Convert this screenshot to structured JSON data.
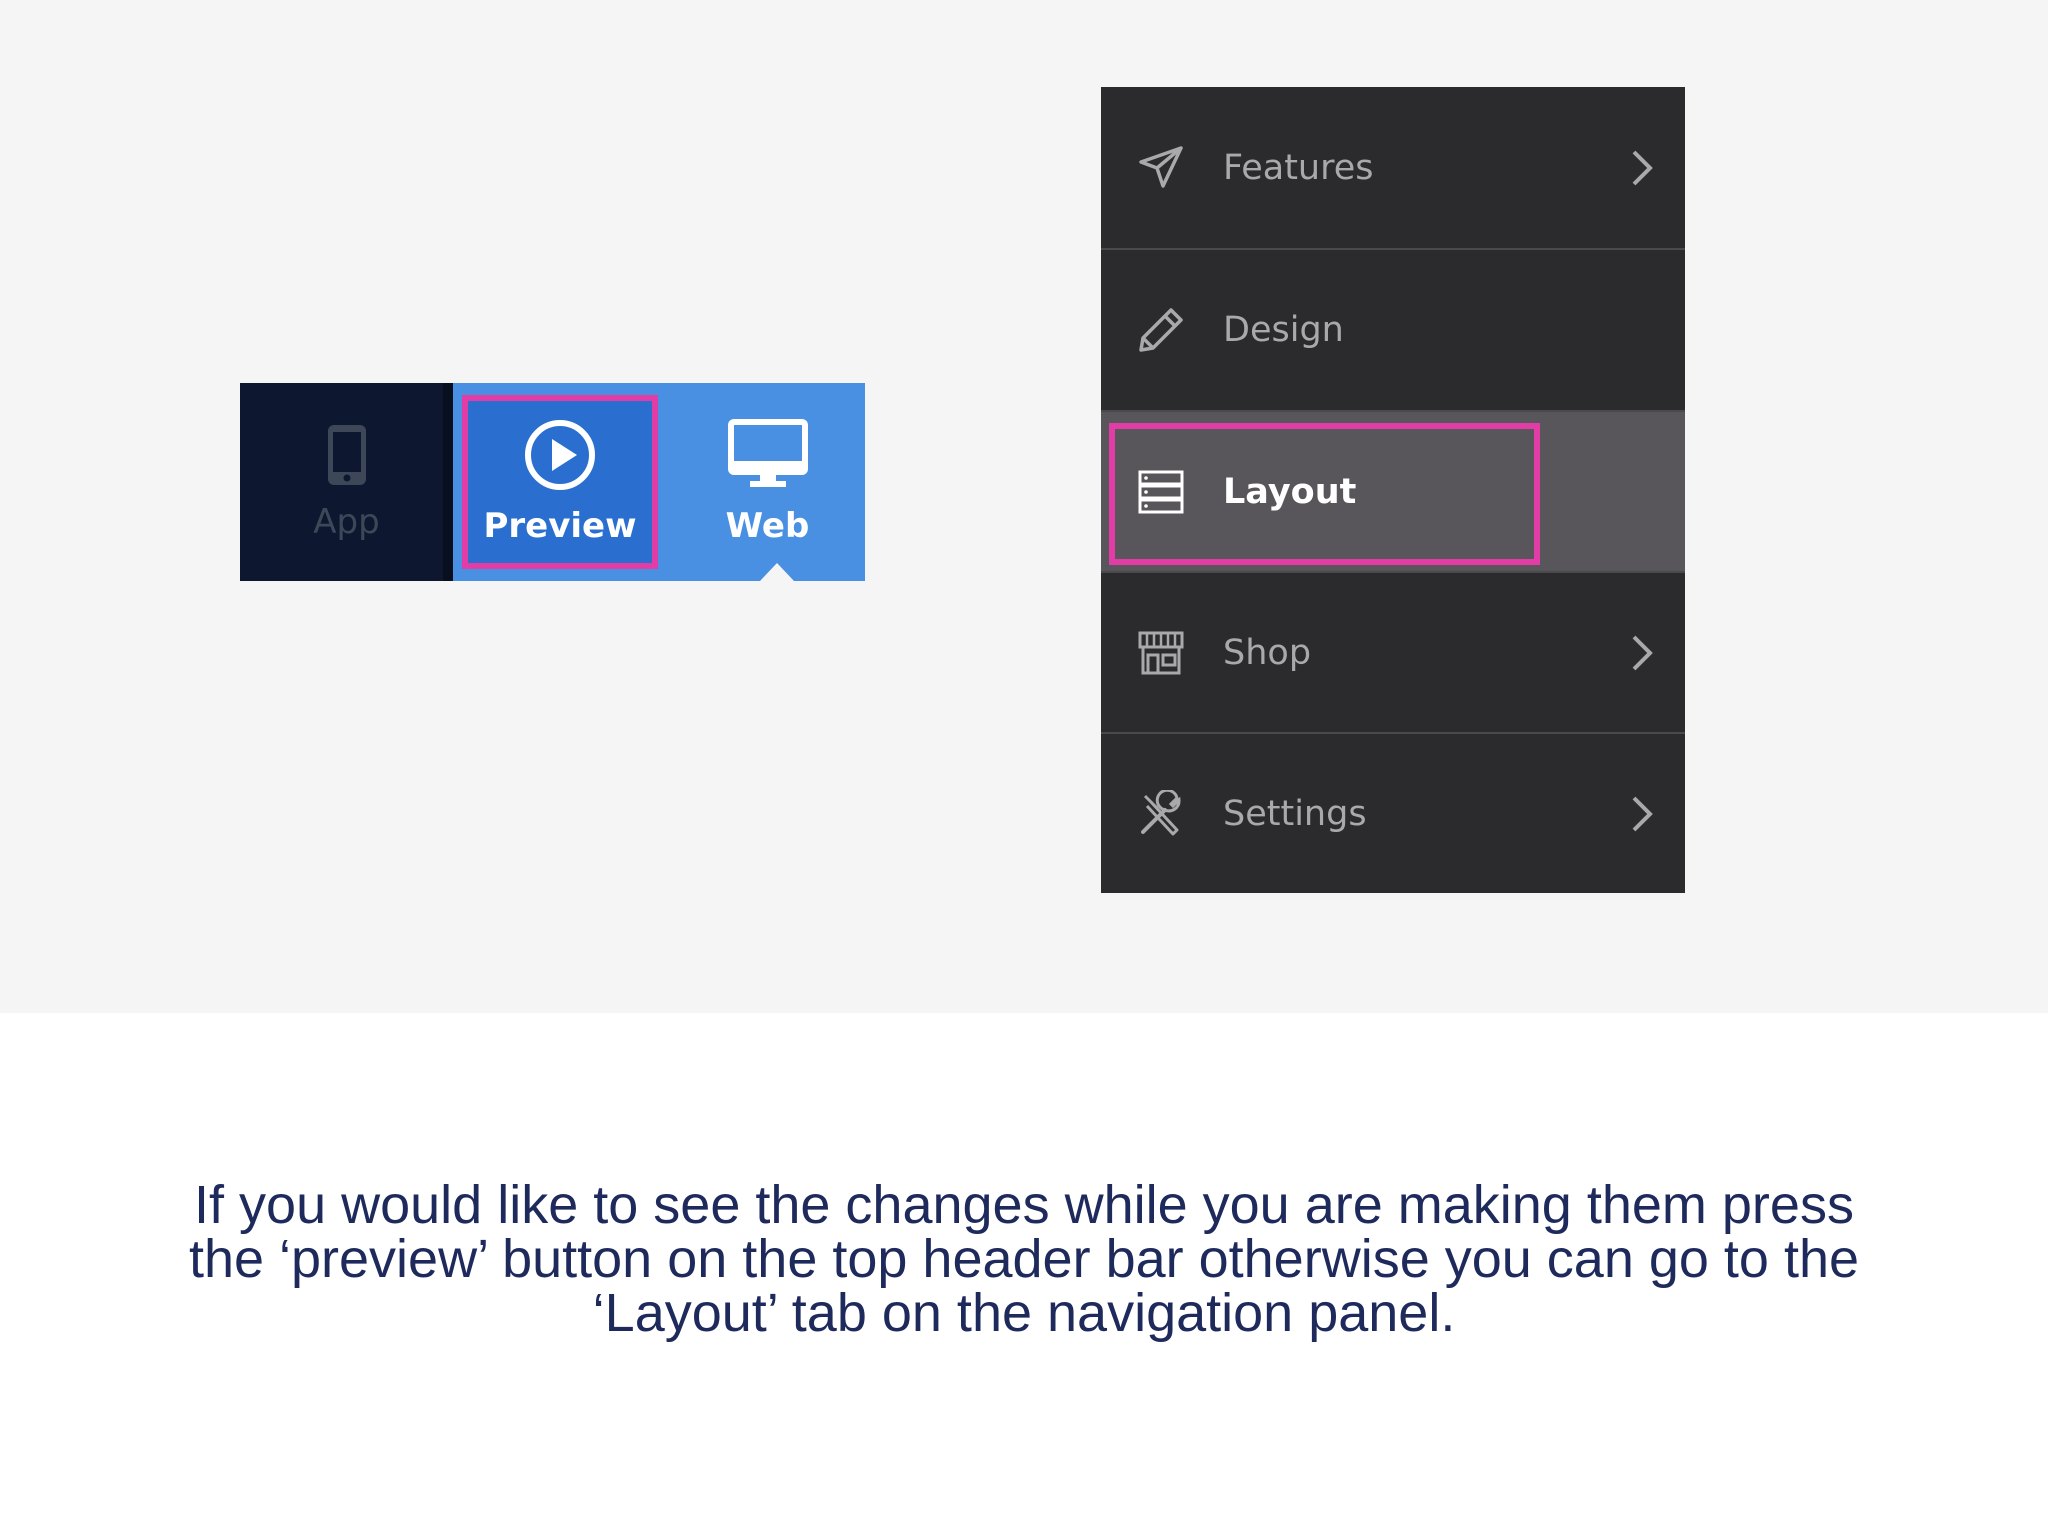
{
  "toolbar": {
    "app_label": "App",
    "preview_label": "Preview",
    "web_label": "Web"
  },
  "nav": {
    "items": [
      {
        "label": "Features",
        "icon": "paper-plane-icon",
        "has_chevron": true
      },
      {
        "label": "Design",
        "icon": "pencil-icon",
        "has_chevron": false
      },
      {
        "label": "Layout",
        "icon": "layout-rows-icon",
        "has_chevron": false,
        "active": true
      },
      {
        "label": "Shop",
        "icon": "storefront-icon",
        "has_chevron": true
      },
      {
        "label": "Settings",
        "icon": "tools-icon",
        "has_chevron": true
      }
    ]
  },
  "caption": {
    "text": "If you would like to see the changes while you are making them press the ‘preview’ button on the top header bar otherwise you can go to the ‘Layout’ tab on the navigation panel."
  },
  "colors": {
    "highlight": "#e23ca6",
    "toolbar_blue": "#4a90e2",
    "toolbar_dark": "#0d1830",
    "nav_bg": "#2b2a2c",
    "nav_active": "#58565a",
    "caption_text": "#1f2a5c"
  }
}
